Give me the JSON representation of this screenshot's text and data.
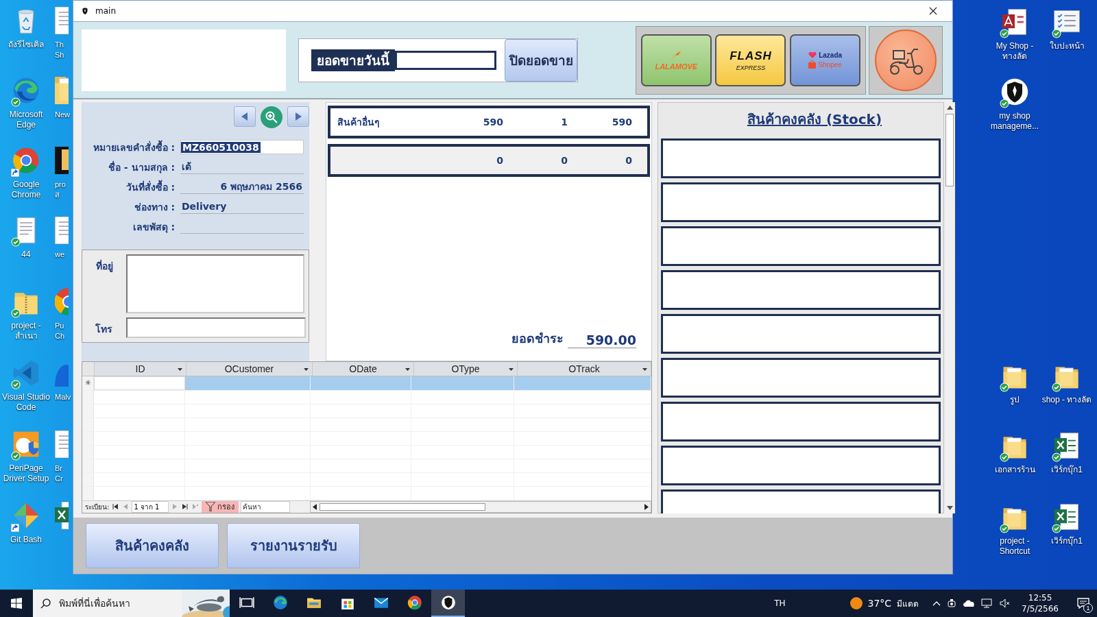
{
  "desktop": {
    "left_icons": [
      {
        "label": "ถังรีไซเคิล",
        "kind": "recycle",
        "synced": false,
        "shortcut": false
      },
      {
        "label": "Microsoft Edge",
        "kind": "edge",
        "synced": true,
        "shortcut": false
      },
      {
        "label": "Google Chrome",
        "kind": "chrome",
        "synced": false,
        "shortcut": true
      },
      {
        "label": "44",
        "kind": "doc",
        "synced": true,
        "shortcut": false
      },
      {
        "label": "project - สำเนา",
        "kind": "zip",
        "synced": true,
        "shortcut": false
      },
      {
        "label": "Visual Studio Code",
        "kind": "vscode",
        "synced": true,
        "shortcut": false
      },
      {
        "label": "PeriPage Driver Setup",
        "kind": "setup",
        "synced": true,
        "shortcut": false
      },
      {
        "label": "Git Bash",
        "kind": "git",
        "synced": false,
        "shortcut": true
      }
    ],
    "partial_icons": [
      {
        "label": "Th Sh",
        "kind": "doc"
      },
      {
        "label": "New",
        "kind": "folder"
      },
      {
        "label": "pro ส",
        "kind": "dark"
      },
      {
        "label": "we",
        "kind": "doc"
      },
      {
        "label": "Pu Ch",
        "kind": "chrome"
      },
      {
        "label": "Malv",
        "kind": "malv"
      },
      {
        "label": "Br Cr",
        "kind": "doc"
      },
      {
        "kind": "excel"
      }
    ],
    "right_icons": [
      {
        "label": "My Shop - ทางลัด",
        "kind": "access",
        "synced": true
      },
      {
        "label": "ใบปะหน้า",
        "kind": "list",
        "synced": true
      },
      {
        "label": "my shop manageme...",
        "kind": "shield",
        "synced": true
      },
      {
        "label": "รูป",
        "kind": "folder",
        "synced": true
      },
      {
        "label": "shop - ทางลัด",
        "kind": "folder",
        "synced": true
      },
      {
        "label": "เอกสารร้าน",
        "kind": "folder",
        "synced": true
      },
      {
        "label": "เวิร์กบุ๊ก1",
        "kind": "excel",
        "synced": true
      },
      {
        "label": "project - Shortcut",
        "kind": "folder",
        "synced": true
      },
      {
        "label": "เวิร์กบุ๊ก1",
        "kind": "excel",
        "synced": true
      }
    ]
  },
  "window": {
    "title": "main"
  },
  "header": {
    "sales_today": {
      "label": "ยอดขายวันนี้"
    },
    "close_sales_button": "ปิดยอดขาย",
    "carriers": [
      {
        "kind": "lalamove",
        "labels": [
          "LALAMOVE"
        ]
      },
      {
        "kind": "flash",
        "labels": [
          "FLASH",
          "EXPRESS"
        ]
      },
      {
        "kind": "marketplace",
        "labels": [
          "Lazada",
          "Shopee"
        ]
      }
    ]
  },
  "order_form": {
    "fields": [
      {
        "label": "หมายเลขคำสั่งซื้อ :",
        "value": "MZ660510038",
        "kind": "line",
        "selected": true
      },
      {
        "label": "ชื่อ - นามสกุล :",
        "value": "เต้",
        "kind": "line",
        "selected": false
      },
      {
        "label": "วันที่สั่งซื้อ :",
        "value": "6 พฤษภาคม 2566",
        "kind": "date",
        "selected": false
      },
      {
        "label": "ช่องทาง :",
        "value": "Delivery",
        "kind": "line",
        "selected": false
      },
      {
        "label": "เลขพัสดุ :",
        "kind": "line",
        "selected": false
      }
    ],
    "address": {
      "label": "ที่อยู่"
    },
    "phone": {
      "label": "โทร"
    }
  },
  "items": [
    {
      "name": "สินค้าอื่นๆ",
      "price": "590",
      "qty": "1",
      "total": "590",
      "selected": false
    },
    {
      "price": "0",
      "qty": "0",
      "total": "0",
      "selected": true
    }
  ],
  "total": {
    "label": "ยอดชำระ",
    "value": "590.00"
  },
  "stock": {
    "title": "สินค้าคงคลัง (Stock)"
  },
  "grid": {
    "columns": [
      "ID",
      "OCustomer",
      "ODate",
      "OType",
      "OTrack"
    ],
    "new_row_marker": "✳",
    "navigator": {
      "label": "ระเบียน:",
      "position": "1 จาก 1",
      "filter": "กรอง",
      "search_placeholder": "ค้นหา"
    }
  },
  "bottom_buttons": [
    "สินค้าคงคลัง",
    "รายงานรายรับ"
  ],
  "taskbar": {
    "search_placeholder": "พิมพ์ที่นี่เพื่อค้นหา",
    "apps": [
      {
        "kind": "taskview",
        "selected": false
      },
      {
        "kind": "edge",
        "selected": false
      },
      {
        "kind": "explorer",
        "selected": false
      },
      {
        "kind": "store",
        "selected": false
      },
      {
        "kind": "mail",
        "selected": false
      },
      {
        "kind": "chrome",
        "selected": false
      },
      {
        "kind": "shield",
        "selected": true
      }
    ],
    "language": "TH",
    "temperature": "37°C",
    "weather": "มีแดด",
    "time": "12:55",
    "date": "7/5/2566",
    "notifications": "1"
  }
}
